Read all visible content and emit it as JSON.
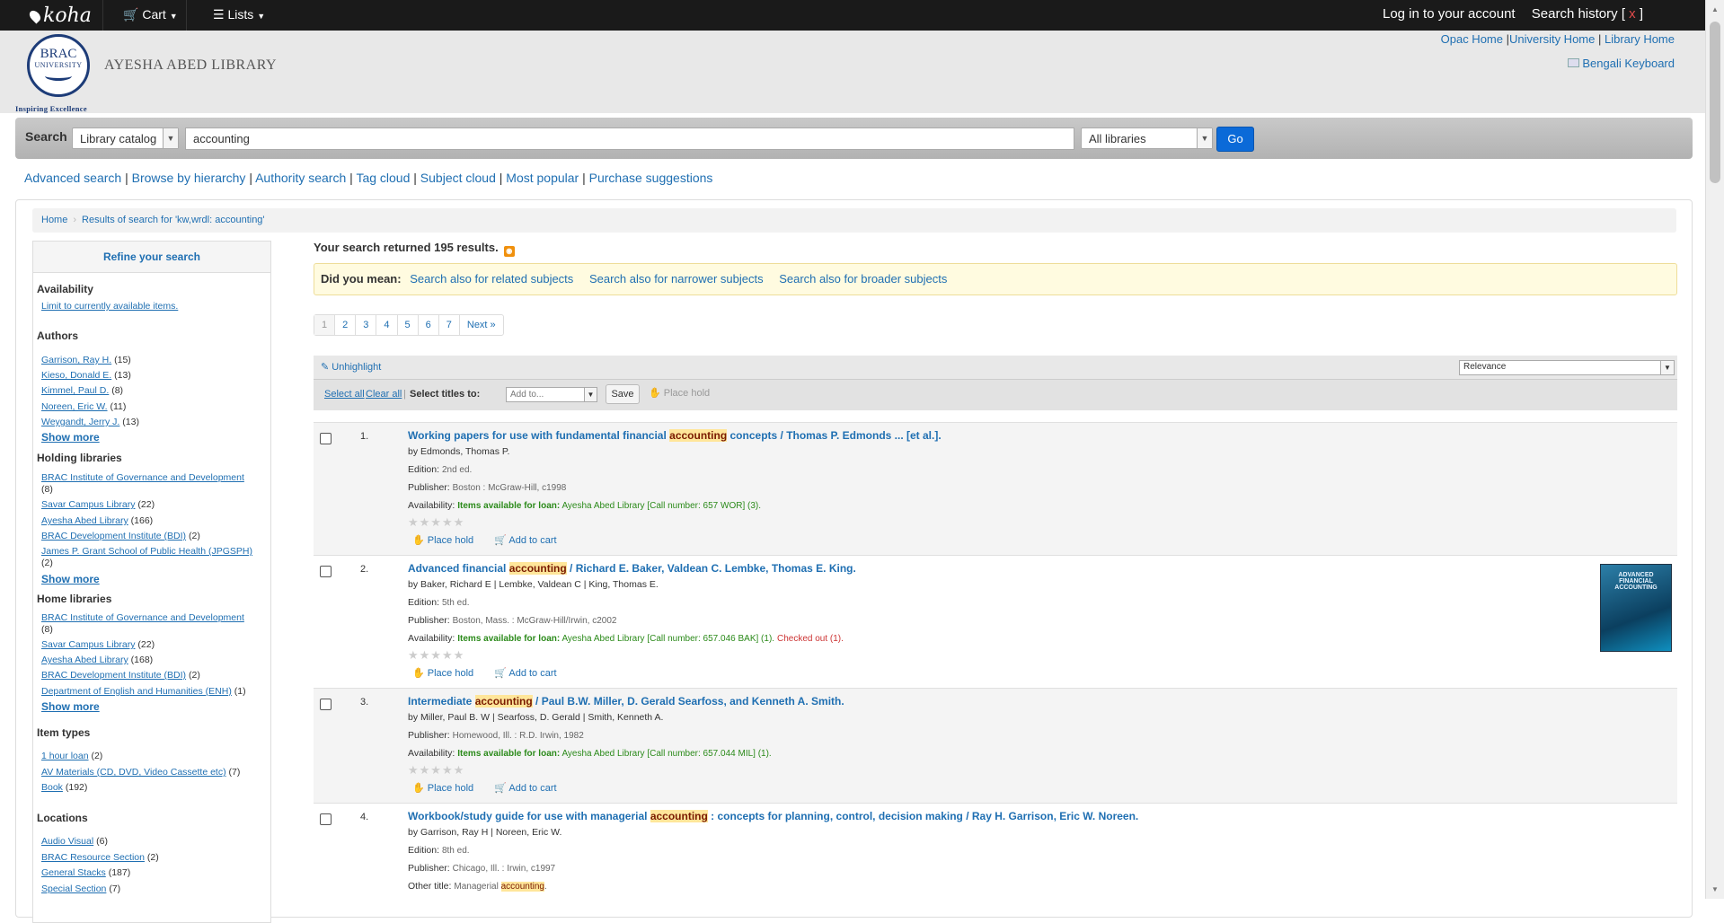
{
  "topbar": {
    "logo": "koha",
    "cart": "Cart",
    "lists": "Lists",
    "login": "Log in to your account",
    "search_history": "Search history",
    "history_close": "x"
  },
  "header": {
    "logo_top": "BRAC",
    "logo_bottom": "UNIVERSITY",
    "tagline": "Inspiring Excellence",
    "library_name": "AYESHA ABED LIBRARY",
    "links": [
      "Opac Home",
      "University Home",
      "Library Home"
    ],
    "keyboard": "Bengali Keyboard"
  },
  "search": {
    "label": "Search",
    "catalog": "Library catalog",
    "query": "accounting",
    "libraries": "All libraries",
    "go": "Go"
  },
  "more_searches": [
    "Advanced search",
    "Browse by hierarchy",
    "Authority search",
    "Tag cloud",
    "Subject cloud",
    "Most popular",
    "Purchase suggestions"
  ],
  "breadcrumbs": {
    "home": "Home",
    "current": "Results of search for 'kw,wrdl: accounting'"
  },
  "facets": {
    "title": "Refine your search",
    "availability": {
      "label": "Availability",
      "link": "Limit to currently available items."
    },
    "authors": {
      "label": "Authors",
      "items": [
        {
          "name": "Garrison, Ray H.",
          "count": "(15)"
        },
        {
          "name": "Kieso, Donald E.",
          "count": "(13)"
        },
        {
          "name": "Kimmel, Paul D.",
          "count": "(8)"
        },
        {
          "name": "Noreen, Eric W.",
          "count": "(11)"
        },
        {
          "name": "Weygandt, Jerry J.",
          "count": "(13)"
        }
      ]
    },
    "holding": {
      "label": "Holding libraries",
      "items": [
        {
          "name": "BRAC Institute of Governance and Development",
          "count": "(8)"
        },
        {
          "name": "Savar Campus Library",
          "count": "(22)"
        },
        {
          "name": "Ayesha Abed Library",
          "count": "(166)"
        },
        {
          "name": "BRAC Development Institute (BDI)",
          "count": "(2)"
        },
        {
          "name": "James P. Grant School of Public Health (JPGSPH)",
          "count": "(2)"
        }
      ]
    },
    "home": {
      "label": "Home libraries",
      "items": [
        {
          "name": "BRAC Institute of Governance and Development",
          "count": "(8)"
        },
        {
          "name": "Savar Campus Library",
          "count": "(22)"
        },
        {
          "name": "Ayesha Abed Library",
          "count": "(168)"
        },
        {
          "name": "BRAC Development Institute (BDI)",
          "count": "(2)"
        },
        {
          "name": "Department of English and Humanities (ENH)",
          "count": "(1)"
        }
      ]
    },
    "itemtypes": {
      "label": "Item types",
      "items": [
        {
          "name": "1 hour loan",
          "count": "(2)"
        },
        {
          "name": "AV Materials (CD, DVD, Video Cassette etc)",
          "count": "(7)"
        },
        {
          "name": "Book",
          "count": "(192)"
        }
      ]
    },
    "locations": {
      "label": "Locations",
      "items": [
        {
          "name": "Audio Visual",
          "count": "(6)"
        },
        {
          "name": "BRAC Resource Section",
          "count": "(2)"
        },
        {
          "name": "General Stacks",
          "count": "(187)"
        },
        {
          "name": "Special Section",
          "count": "(7)"
        }
      ]
    },
    "show_more": "Show more"
  },
  "results": {
    "summary": "Your search returned 195 results.",
    "did_you_mean": {
      "label": "Did you mean:",
      "links": [
        "Search also for related subjects",
        "Search also for narrower subjects",
        "Search also for broader subjects"
      ]
    },
    "pages": [
      "1",
      "2",
      "3",
      "4",
      "5",
      "6",
      "7",
      "Next »"
    ],
    "unhighlight": "Unhighlight",
    "sort": "Relevance",
    "select_all": "Select all",
    "clear_all": "Clear all",
    "select_titles": "Select titles to:",
    "add_to": "Add to...",
    "save": "Save",
    "place_hold": "Place hold",
    "add_to_cart": "Add to cart",
    "stars": "★★★★★",
    "labels": {
      "edition": "Edition:",
      "publisher": "Publisher:",
      "availability": "Availability:",
      "other_title": "Other title:",
      "items_available": "Items available for loan:"
    },
    "items": [
      {
        "num": "1.",
        "title_pre": "Working papers for use with fundamental financial ",
        "title_hl": "accounting",
        "title_post": " concepts / Thomas P. Edmonds ... [et al.].",
        "by": "by Edmonds, Thomas P.",
        "edition": "2nd ed.",
        "publisher": "Boston : McGraw-Hill, c1998",
        "availability": "Ayesha Abed Library [Call number: 657 WOR] (3)."
      },
      {
        "num": "2.",
        "title_pre": "Advanced financial ",
        "title_hl": "accounting",
        "title_post": " / Richard E. Baker, Valdean C. Lembke, Thomas E. King.",
        "by": "by Baker, Richard E | Lembke, Valdean C | King, Thomas E.",
        "edition": "5th ed.",
        "publisher": "Boston, Mass. : McGraw-Hill/Irwin, c2002",
        "availability": "Ayesha Abed Library [Call number: 657.046 BAK] (1).",
        "checked_out": "Checked out (1).",
        "cover_text": "ADVANCED FINANCIAL ACCOUNTING"
      },
      {
        "num": "3.",
        "title_pre": "Intermediate ",
        "title_hl": "accounting",
        "title_post": " / Paul B.W. Miller, D. Gerald Searfoss, and Kenneth A. Smith.",
        "by": "by Miller, Paul B. W | Searfoss, D. Gerald | Smith, Kenneth A.",
        "publisher": "Homewood, Ill. : R.D. Irwin, 1982",
        "availability": "Ayesha Abed Library [Call number: 657.044 MIL] (1)."
      },
      {
        "num": "4.",
        "title_pre": "Workbook/study guide for use with managerial ",
        "title_hl": "accounting",
        "title_post": " : concepts for planning, control, decision making / Ray H. Garrison, Eric W. Noreen.",
        "by": "by Garrison, Ray H | Noreen, Eric W.",
        "edition": "8th ed.",
        "publisher": "Chicago, Ill. : Irwin, c1997",
        "other_title_pre": "Managerial ",
        "other_title_hl": "accounting",
        "other_title_post": "."
      }
    ]
  }
}
